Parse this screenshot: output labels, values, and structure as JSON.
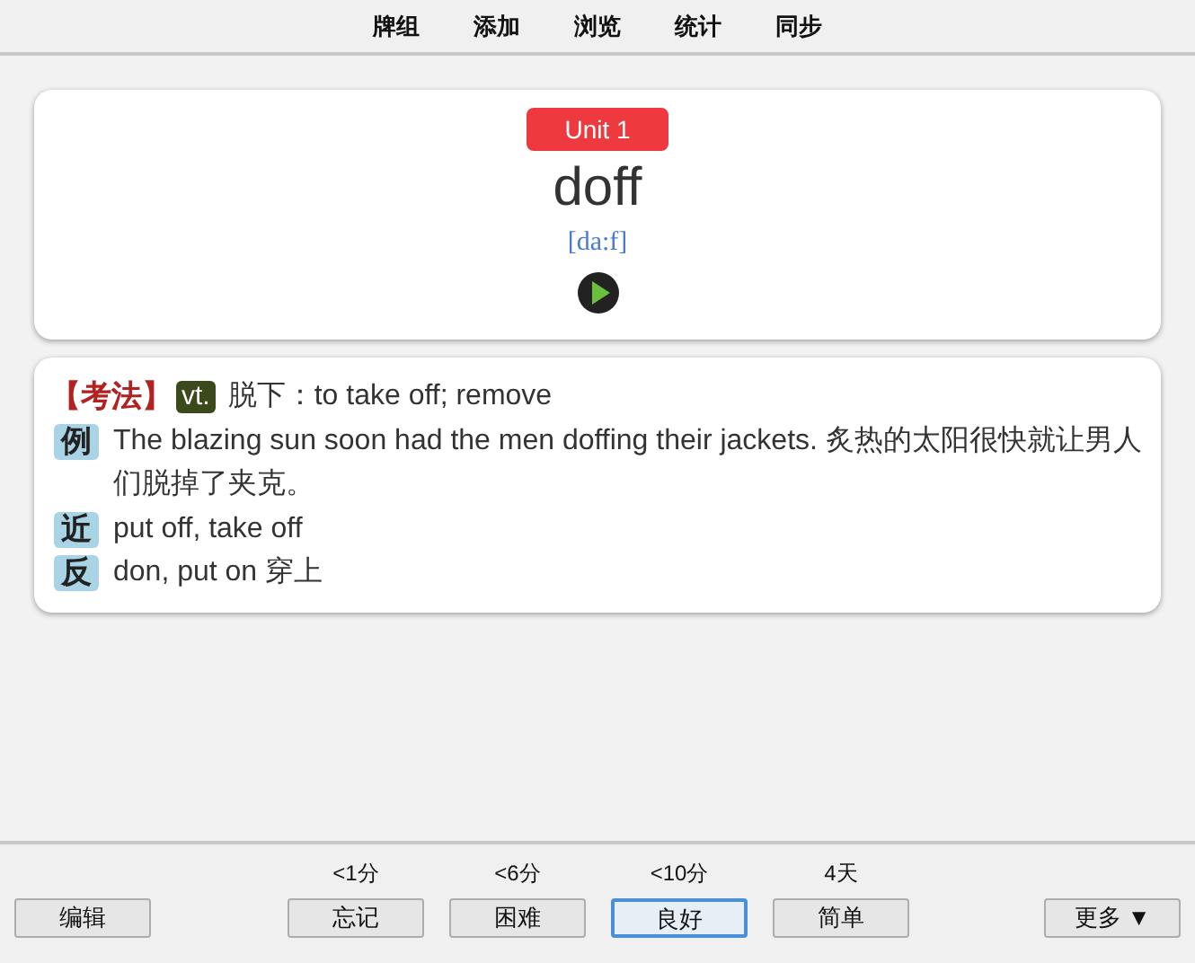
{
  "menu": [
    "牌组",
    "添加",
    "浏览",
    "统计",
    "同步"
  ],
  "card": {
    "unit": "Unit 1",
    "word": "doff",
    "phonetic": "[da:f]"
  },
  "definition": {
    "exam_label": "【考法】",
    "pos": "vt.",
    "meaning": "脱下：to take off; remove",
    "entries": [
      {
        "tag": "例",
        "text": "The blazing sun soon had the men doffing their jackets. 炙热的太阳很快就让男人们脱掉了夹克。"
      },
      {
        "tag": "近",
        "text": "put off, take off"
      },
      {
        "tag": "反",
        "text": "don, put on 穿上"
      }
    ]
  },
  "bottom": {
    "edit": "编辑",
    "more": "更多 ▼",
    "answers": [
      {
        "interval": "<1分",
        "label": "忘记",
        "selected": false
      },
      {
        "interval": "<6分",
        "label": "困难",
        "selected": false
      },
      {
        "interval": "<10分",
        "label": "良好",
        "selected": true
      },
      {
        "interval": "4天",
        "label": "简单",
        "selected": false
      }
    ]
  }
}
